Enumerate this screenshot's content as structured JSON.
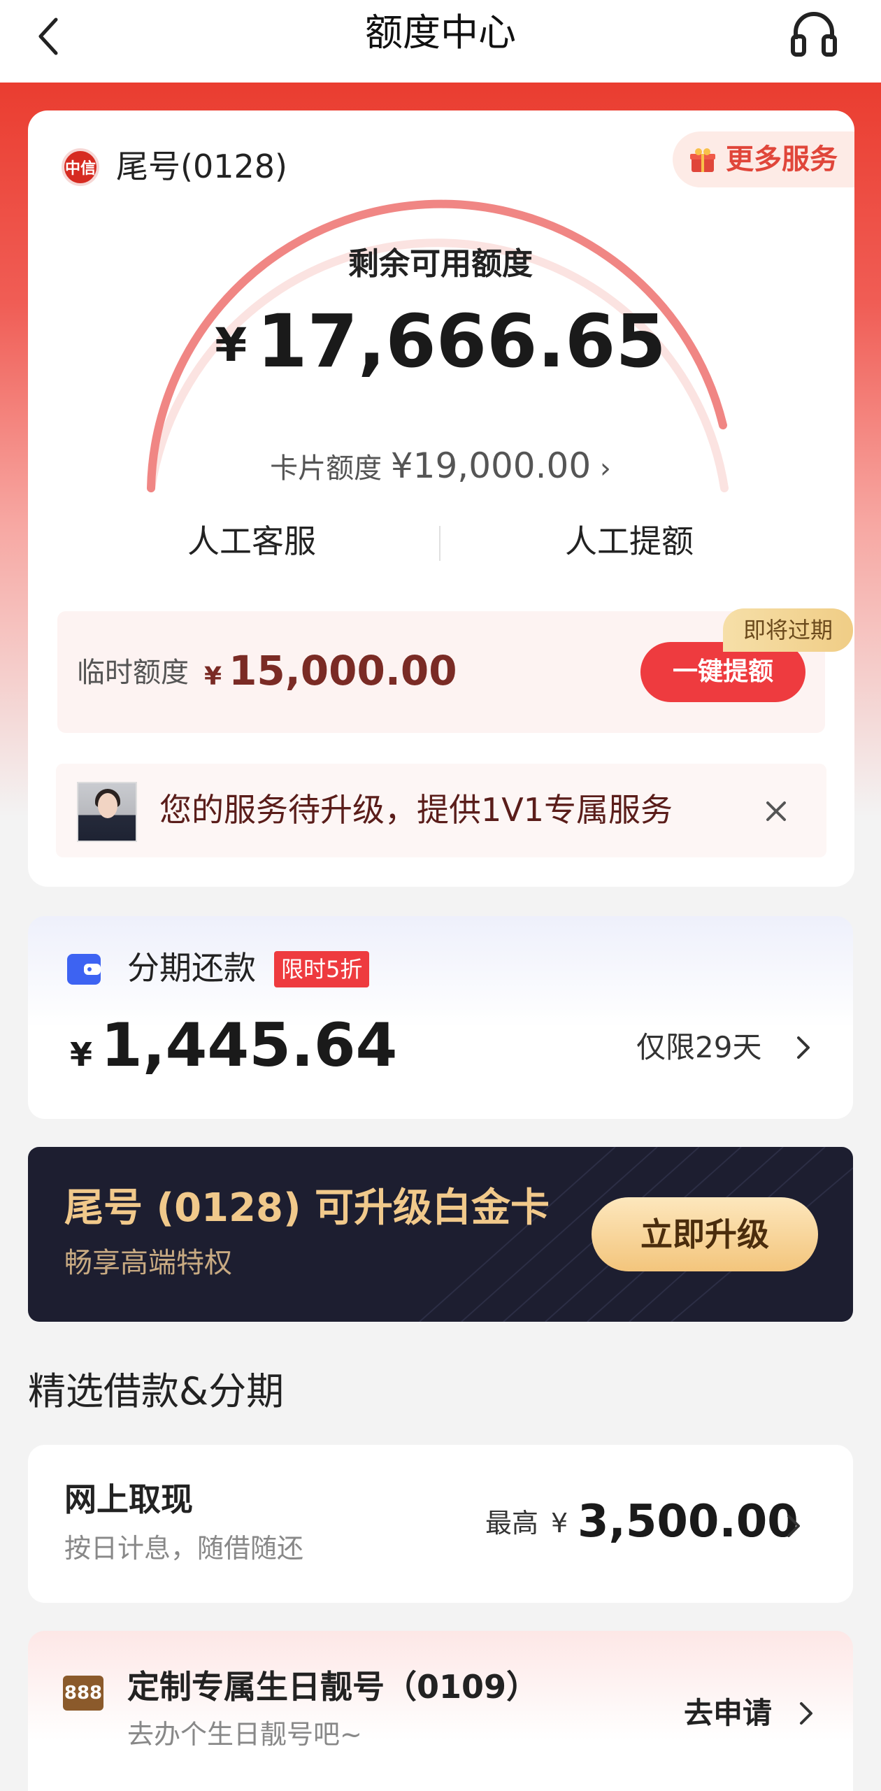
{
  "header": {
    "title": "额度中心"
  },
  "main_card": {
    "card_tail": "尾号(0128)",
    "bank_logo_text": "中信",
    "more_service": "更多服务",
    "remain_label": "剩余可用额度",
    "currency": "¥",
    "remain_amount": "17,666.65",
    "card_limit_label": "卡片额度",
    "card_limit_amount": "¥19,000.00",
    "card_limit_chevron": "›",
    "service_left": "人工客服",
    "service_right": "人工提额",
    "temp_label": "临时额度",
    "temp_amount": "15,000.00",
    "one_click_button": "一键提额",
    "expire_badge": "即将过期",
    "upgrade_notice": "您的服务待升级，提供1V1专属服务"
  },
  "installment": {
    "title": "分期还款",
    "badge": "限时5折",
    "amount": "1,445.64",
    "days": "仅限29天"
  },
  "platinum": {
    "title": "尾号 (0128) 可升级白金卡",
    "subtitle": "畅享高端特权",
    "button": "立即升级"
  },
  "section_title": "精选借款&分期",
  "cash": {
    "title": "网上取现",
    "subtitle": "按日计息，随借随还",
    "max_label": "最高",
    "amount": "3,500.00"
  },
  "birthday": {
    "icon_text": "888",
    "title": "定制专属生日靓号（0109）",
    "subtitle": "去办个生日靓号吧~",
    "apply": "去申请"
  }
}
